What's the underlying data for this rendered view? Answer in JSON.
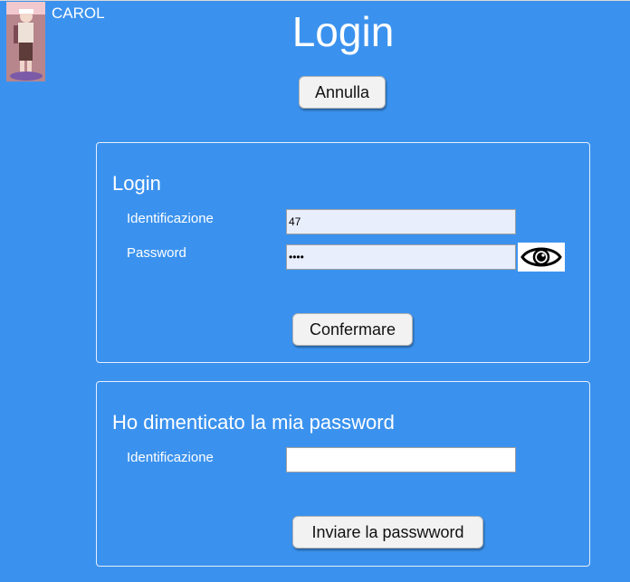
{
  "user": {
    "name": "CAROL"
  },
  "header": {
    "title": "Login",
    "cancel_label": "Annulla"
  },
  "login_panel": {
    "title": "Login",
    "id_label": "Identificazione",
    "id_value": "47",
    "password_label": "Password",
    "password_value": "••••",
    "confirm_label": "Confermare"
  },
  "forgot_panel": {
    "title": "Ho dimenticato la mia password",
    "id_label": "Identificazione",
    "id_value": "",
    "send_label": "Inviare la passwword"
  },
  "colors": {
    "background": "#3b92ee",
    "panel_border": "#e6eefb",
    "input_fill": "#e8eefc"
  },
  "icons": {
    "avatar": "user-photo",
    "password_toggle": "eye-icon"
  }
}
